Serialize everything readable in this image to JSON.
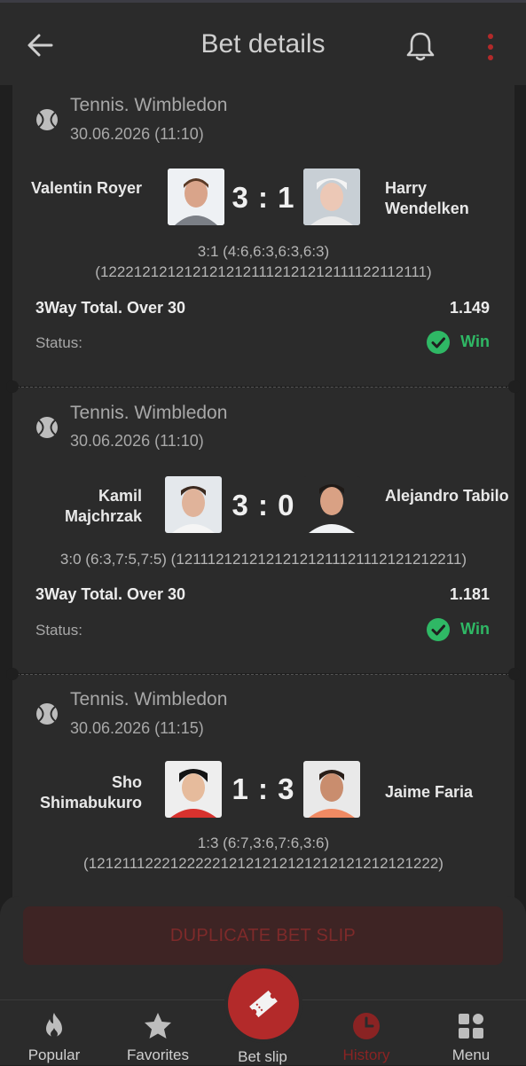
{
  "header": {
    "title": "Bet details",
    "back_icon": "arrow-left-icon",
    "bell_icon": "bell-icon",
    "menu_icon": "more-vertical-icon"
  },
  "bets": [
    {
      "league": "Tennis. Wimbledon",
      "date": "30.06.2026 (11:10)",
      "player1": "Valentin Royer",
      "player2": "Harry Wendelken",
      "score": "3 : 1",
      "detail_line1": "3:1 (4:6,6:3,6:3,6:3)",
      "detail_line2": "(1222121212121212121112121212111122112111)",
      "market": "3Way Total. Over 30",
      "odds": "1.149",
      "status_label": "Status:",
      "status": "Win"
    },
    {
      "league": "Tennis. Wimbledon",
      "date": "30.06.2026 (11:10)",
      "player1": "Kamil Majchrzak",
      "player2": "Alejandro Tabilo",
      "score": "3 : 0",
      "detail_line1": "3:0 (6:3,7:5,7:5) (12111212121212121211121112121212211)",
      "market": "3Way Total. Over 30",
      "odds": "1.181",
      "status_label": "Status:",
      "status": "Win"
    },
    {
      "league": "Tennis. Wimbledon",
      "date": "30.06.2026 (11:15)",
      "player1": "Sho Shimabukuro",
      "player2": "Jaime Faria",
      "score": "1 : 3",
      "detail_line1": "1:3 (6:7,3:6,7:6,3:6)",
      "detail_line2": "(121211122212222212121212121212121212121222)"
    }
  ],
  "duplicate_button": "DUPLICATE BET SLIP",
  "nav": [
    {
      "label": "Popular",
      "icon": "flame-icon"
    },
    {
      "label": "Favorites",
      "icon": "star-icon"
    },
    {
      "label": "Bet slip",
      "icon": "ticket-icon"
    },
    {
      "label": "History",
      "icon": "clock-icon",
      "active": true
    },
    {
      "label": "Menu",
      "icon": "grid-icon"
    }
  ],
  "colors": {
    "background": "#1f1f1f",
    "card": "#2b2b2b",
    "accent_red": "#b32a2a",
    "win_green": "#2fb865",
    "muted_text": "#a8a8a8"
  }
}
